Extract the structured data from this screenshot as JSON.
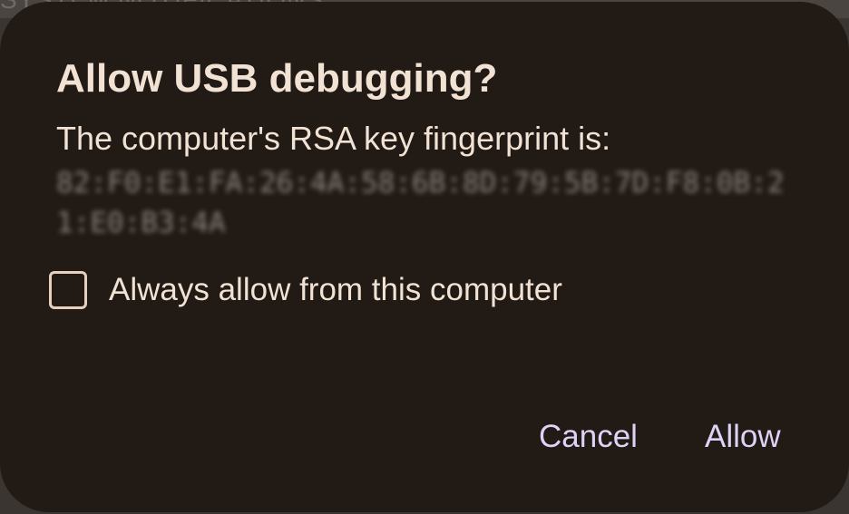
{
  "background": {
    "partial_text": "SYSTEM NOTIFICATIONS"
  },
  "dialog": {
    "title": "Allow USB debugging?",
    "message": "The computer's RSA key fingerprint is:",
    "fingerprint_redacted": "82:F0:E1:FA:26:4A:58:6B:8D:79:5B:7D:F8:0B:21:E0:B3:4A",
    "checkbox": {
      "label": "Always allow from this computer",
      "checked": false
    },
    "buttons": {
      "cancel_label": "Cancel",
      "allow_label": "Allow"
    }
  },
  "colors": {
    "dialog_bg": "#211a15",
    "text": "#f2e2d4",
    "button_text": "#ddd3f6",
    "checkbox_border": "#e6d0bd"
  }
}
